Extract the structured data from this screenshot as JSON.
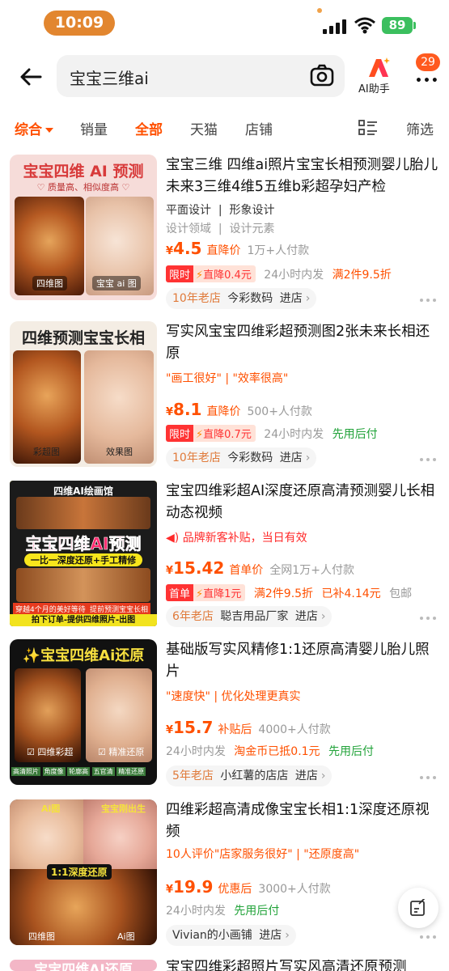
{
  "status": {
    "time": "10:09",
    "battery": "89"
  },
  "search": {
    "query": "宝宝三维ai"
  },
  "ai_helper": {
    "label": "AI助手"
  },
  "more": {
    "badge": "29"
  },
  "tabs": {
    "comprehensive": "综合",
    "sales": "销量",
    "all": "全部",
    "tmall": "天猫",
    "store": "店铺",
    "filter": "筛选"
  },
  "products": [
    {
      "thumb_title": "宝宝四维 AI 预测",
      "thumb_sub": "♡ 质量高、相似度高 ♡",
      "thumb_left": "四维图",
      "thumb_right": "宝宝 ai 图",
      "title": "宝宝三维 四维ai照片宝宝长相预测婴儿胎儿未来3三维4维5五维b彩超孕妇产检",
      "attr1_v": "平面设计",
      "attr1_k": "设计领域",
      "attr2_v": "形象设计",
      "attr2_k": "设计元素",
      "yen": "¥",
      "price": "4.5",
      "price_label": "直降价",
      "sold": "1万+人付款",
      "promo_tag": "限时",
      "promo_drop": "直降0.4元",
      "ship": "24小时内发",
      "extra": "满2件9.5折",
      "store_years": "10年老店",
      "store_name": "今彩数码",
      "store_enter": "进店"
    },
    {
      "thumb_title": "四维预测宝宝长相",
      "thumb_left": "彩超图",
      "thumb_right": "效果图",
      "title": "写实风宝宝四维彩超预测图2张未来长相还原",
      "quote": "\"画工很好\" | \"效率很高\"",
      "yen": "¥",
      "price": "8.1",
      "price_label": "直降价",
      "sold": "500+人付款",
      "promo_tag": "限时",
      "promo_drop": "直降0.7元",
      "ship": "24小时内发",
      "extra": "先用后付",
      "store_years": "10年老店",
      "store_name": "今彩数码",
      "store_enter": "进店"
    },
    {
      "thumb_header": "四维AI绘画馆",
      "thumb_title": "宝宝四维AI预测",
      "thumb_sub": "一比一深度还原+手工精修",
      "thumb_banner1": "穿越4个月的美好等待",
      "thumb_banner2": "提前预测宝宝长相",
      "thumb_footer": "拍下订单-提供四维照片-出图",
      "title": "宝宝四维彩超AI深度还原高清预测婴儿长相动态视频",
      "subsidy": "品牌新客补贴，当日有效",
      "yen": "¥",
      "price": "15.42",
      "price_label": "首单价",
      "sold": "全网1万+人付款",
      "promo_tag": "首单",
      "promo_drop": "直降1元",
      "extra": "满2件9.5折",
      "extra2": "已补4.14元",
      "extra3": "包邮",
      "store_years": "6年老店",
      "store_name": "聪吉用品厂家",
      "store_enter": "进店"
    },
    {
      "thumb_title": "✨宝宝四维Ai还原",
      "thumb_left": "四维彩超",
      "thumb_right": "精准还原",
      "thumb_strip": [
        "高清照片",
        "角度像",
        "轮廓高",
        "五官清",
        "精准还原"
      ],
      "title": "基础版写实风精修1:1还原高清婴儿胎儿照片",
      "quote": "\"速度快\" | 优化处理更真实",
      "yen": "¥",
      "price": "15.7",
      "price_label": "补贴后",
      "sold": "4000+人付款",
      "ship": "24小时内发",
      "extra": "淘金币已抵0.1元",
      "extra2": "先用后付",
      "store_years": "5年老店",
      "store_name": "小红薯的店店",
      "store_enter": "进店"
    },
    {
      "thumb_tl": "Ai图",
      "thumb_tr": "宝宝刚出生",
      "thumb_mid": "1:1深度还原",
      "thumb_bl": "四维图",
      "thumb_br": "Ai图",
      "title": "四维彩超高清成像宝宝长相1:1深度还原视频",
      "quote": "10人评价\"店家服务很好\" | \"还原度高\"",
      "yen": "¥",
      "price": "19.9",
      "price_label": "优惠后",
      "sold": "3000+人付款",
      "ship": "24小时内发",
      "extra": "先用后付",
      "store_name": "Vivian的小画铺",
      "store_enter": "进店"
    },
    {
      "thumb_title": "宝宝四维AI还原",
      "title": "宝宝四维彩超照片写实风高清还原预测"
    }
  ],
  "colors": {
    "accent": "#ff5000",
    "green": "#22a33a",
    "badge_red": "#ff3333"
  }
}
